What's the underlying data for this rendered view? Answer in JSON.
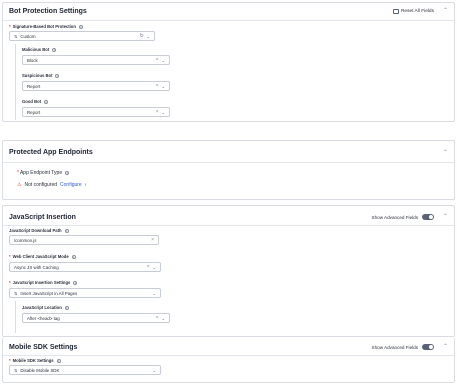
{
  "bot_protection": {
    "title": "Bot Protection Settings",
    "reset_label": "Reset All Fields",
    "signature_label": "Signature-Based Bot Protection",
    "signature_value": "Custom",
    "malicious_label": "Malicious Bot",
    "malicious_value": "Block",
    "suspicious_label": "Suspicious Bot",
    "suspicious_value": "Report",
    "good_label": "Good Bot",
    "good_value": "Report"
  },
  "endpoints": {
    "title": "Protected App Endpoints",
    "type_label": "App Endpoint Type",
    "status": "Not configured",
    "configure_link": "Configure"
  },
  "js_insertion": {
    "title": "JavaScript Insertion",
    "advanced_label": "Show Advanced Fields",
    "download_path_label": "JavaScript Download Path",
    "download_path_value": "/common.js",
    "web_mode_label": "Web Client JavaScript Mode",
    "web_mode_value": "Async JS with Caching",
    "insertion_settings_label": "JavaScript Insertion Settings",
    "insertion_settings_value": "Insert JavaScript in All Pages",
    "location_label": "JavaScript Location",
    "location_value": "After <head> tag"
  },
  "mobile_sdk": {
    "title": "Mobile SDK Settings",
    "advanced_label": "Show Advanced Fields",
    "settings_label": "Mobile SDK Settings",
    "settings_value": "Disable Mobile SDK"
  },
  "icons": {
    "info": "info-icon",
    "clear": "clear-icon",
    "chevron": "chevron-down-icon",
    "collapse": "chevron-up-icon",
    "warning": "warning-icon",
    "reset": "reset-icon"
  }
}
